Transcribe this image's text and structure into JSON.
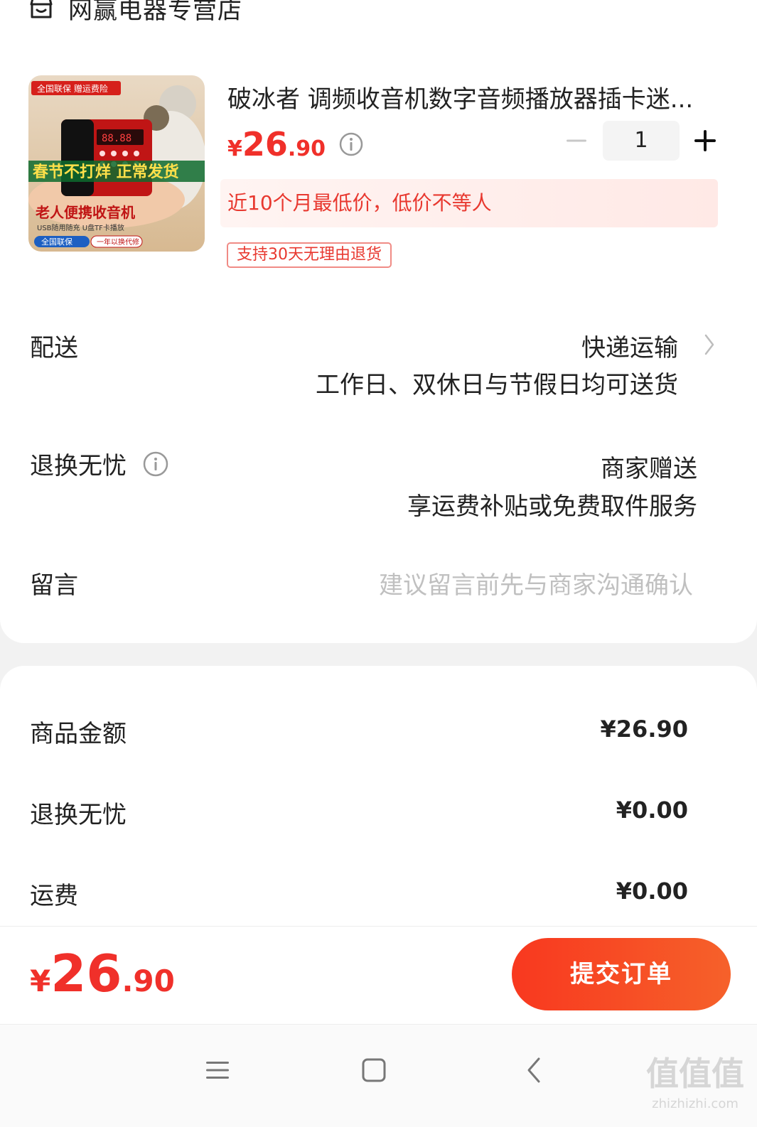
{
  "store": {
    "name": "网赢电器专营店",
    "icon": "store-icon"
  },
  "product": {
    "title": "破冰者 调频收音机数字音频播放器插卡迷...",
    "price_yen": "¥",
    "price_int": "26",
    "price_dec": ".90",
    "quantity": "1",
    "lowprice_text": "近10个月最低价，低价不等人",
    "return_tag": "支持30天无理由退货",
    "image": {
      "banner_text": "全国联保 赠运费险",
      "overlay_text": "春节不打烊 正常发货",
      "caption": "老人便携收音机",
      "sub_caption": "USB随用随充  U盘TF卡播放",
      "footer_left": "全国联保",
      "footer_right": "一年以换代修",
      "display_text": "88.88"
    }
  },
  "rows": {
    "delivery_label": "配送",
    "delivery_value": "快递运输",
    "delivery_sub": "工作日、双休日与节假日均可送货",
    "worry_label": "退换无忧",
    "worry_value": "商家赠送",
    "worry_sub": "享运费补贴或免费取件服务",
    "message_label": "留言",
    "message_placeholder": "建议留言前先与商家沟通确认"
  },
  "summary": {
    "items": [
      {
        "label": "商品金额",
        "value": "¥26.90"
      },
      {
        "label": "退换无忧",
        "value": "¥0.00"
      },
      {
        "label": "运费",
        "value": "¥0.00"
      }
    ]
  },
  "footer": {
    "total_yen": "¥",
    "total_int": "26",
    "total_dec": ".90",
    "submit_label": "提交订单"
  },
  "watermark": {
    "logo": "值值值",
    "url": "zhizhizhi.com"
  },
  "colors": {
    "accent": "#f0302a",
    "button_start": "#f8381f",
    "button_end": "#f6612a"
  }
}
